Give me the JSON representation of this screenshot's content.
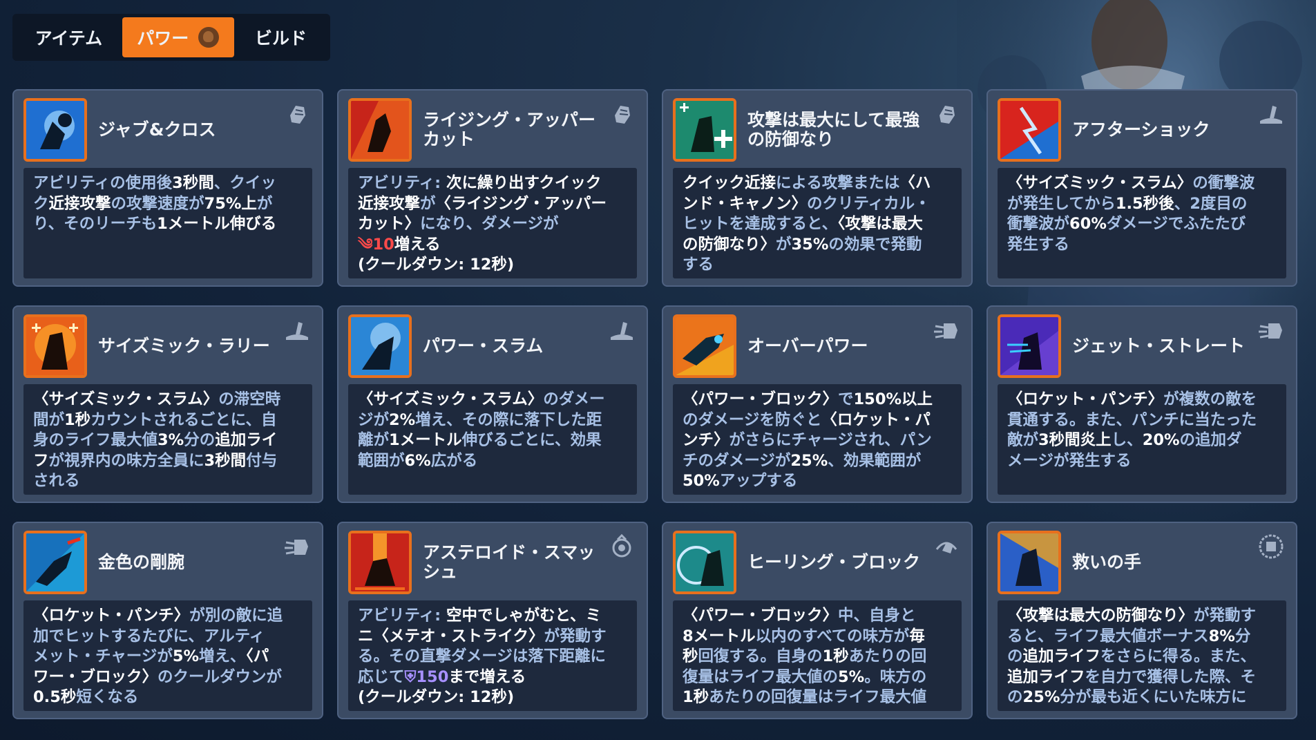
{
  "tabs": {
    "items": "アイテム",
    "power": "パワー",
    "build": "ビルド"
  },
  "cards": [
    {
      "title": "ジャブ&クロス",
      "category": "punch-fist-icon",
      "d1": "アビリティの使用後",
      "d2": "3秒間",
      "d3": "、クイッ\nク",
      "d4": "近接攻撃",
      "d5": "の攻撃速度が",
      "d6": "75%上",
      "d7": "が\nり、そのリーチも",
      "d8": "1メートル伸びる"
    },
    {
      "title": "ライジング・アッパーカット",
      "category": "punch-fist-icon",
      "d1": "アビリティ: ",
      "d2": "次に繰り出す",
      "d3": "クイック\n近接攻撃",
      "d4": "が",
      "d5": "〈ライジング・アッパー\nカット〉",
      "d6": "になり、ダメージが",
      "d7": "\n",
      "d8": "10",
      "d9": "増える\n(クールダウン: 12秒)"
    },
    {
      "title": "攻撃は最大にして最強の防御なり",
      "category": "punch-fist-icon",
      "d1": "クイック近接",
      "d2": "による攻撃または",
      "d3": "〈ハ\nンド・キャノン〉",
      "d4": "のクリティカル・\nヒットを達成すると、",
      "d5": "〈攻撃は最大\nの防御なり〉",
      "d6": "が",
      "d7": "35%",
      "d8": "の効果で発動\nする"
    },
    {
      "title": "アフターショック",
      "category": "slam-wave-icon",
      "d1": "〈サイズミック・スラム〉",
      "d2": "の衝撃波\nが発生してから",
      "d3": "1.5秒後",
      "d4": "、2度目の\n衝撃波が",
      "d5": "60%",
      "d6": "ダメージでふたたび\n発生する"
    },
    {
      "title": "サイズミック・ラリー",
      "category": "slam-wave-icon",
      "d1": "〈サイズミック・スラム〉",
      "d2": "の滞空時\n間が",
      "d3": "1秒",
      "d4": "カウントされるごとに、自\n身のライフ最大値",
      "d5": "3%",
      "d6": "分の",
      "d7": "追加ライ\nフ",
      "d8": "が視界内の味方全員に",
      "d9": "3秒間",
      "d10": "付与\nされる"
    },
    {
      "title": "パワー・スラム",
      "category": "slam-wave-icon",
      "d1": "〈サイズミック・スラム〉",
      "d2": "のダメー\nジが",
      "d3": "2%",
      "d4": "増え、その際に落下した距\n離が",
      "d5": "1メートル",
      "d6": "伸びるごとに、効果\n範囲が",
      "d7": "6%",
      "d8": "広がる"
    },
    {
      "title": "オーバーパワー",
      "category": "rocket-fist-icon",
      "d1": "〈パワー・ブロック〉",
      "d2": "で",
      "d3": "150%以上\n",
      "d4": "のダメージを防ぐと",
      "d5": "〈ロケット・パ\nンチ〉",
      "d6": "がさらにチャージされ、パン\nチのダメージが",
      "d7": "25%",
      "d8": "、効果範囲が\n",
      "d9": "50%",
      "d10": "アップする"
    },
    {
      "title": "ジェット・ストレート",
      "category": "rocket-fist-icon",
      "d1": "〈ロケット・パンチ〉",
      "d2": "が複数の敵を\n貫通する。また、パンチに当たった\n敵が",
      "d3": "3秒間炎上",
      "d4": "し、",
      "d5": "20%",
      "d6": "の追加ダ\nメージが発生する"
    },
    {
      "title": "金色の剛腕",
      "category": "rocket-fist-icon",
      "d1": "〈ロケット・パンチ〉",
      "d2": "が別の敵に追\n加でヒットするたびに、アルティ\nメット・チャージが",
      "d3": "5%",
      "d4": "増え、",
      "d5": "〈パ\nワー・ブロック〉",
      "d6": "のクールダウンが\n",
      "d7": "0.5秒",
      "d8": "短くなる"
    },
    {
      "title": "アステロイド・スマッシュ",
      "category": "meteor-icon",
      "d1": "アビリティ: ",
      "d2": "空中でしゃがむと、",
      "d3": "ミ\nニ〈メテオ・ストライク〉",
      "d4": "が発動す\nる。その直撃ダメージは落下距離に\n応じて",
      "d5": "150",
      "d6": "まで増える",
      "d7": "\n(クールダウン: 12秒)"
    },
    {
      "title": "ヒーリング・ブロック",
      "category": "shield-block-icon",
      "d1": "〈パワー・ブロック〉",
      "d2": "中、自身と\n",
      "d3": "8メートル",
      "d4": "以内のすべての味方が",
      "d5": "毎\n秒",
      "d6": "回復する。自身の",
      "d7": "1秒",
      "d8": "あたりの回\n復量はライフ最大値の",
      "d9": "5%",
      "d10": "。味方の\n",
      "d11": "1秒",
      "d12": "あたりの回復量はライフ最大値"
    },
    {
      "title": "救いの手",
      "category": "hero-badge-icon",
      "d1": "〈攻撃は最大の防御なり〉",
      "d2": "が発動す\nると、ライフ最大値ボーナス",
      "d3": "8%",
      "d4": "分\nの",
      "d5": "追加ライフ",
      "d6": "をさらに得る。また、\n",
      "d7": "追加ライフ",
      "d8": "を自力で獲得した際、そ\nの",
      "d9": "25%",
      "d10": "分が最も近くにいた味方に"
    }
  ]
}
